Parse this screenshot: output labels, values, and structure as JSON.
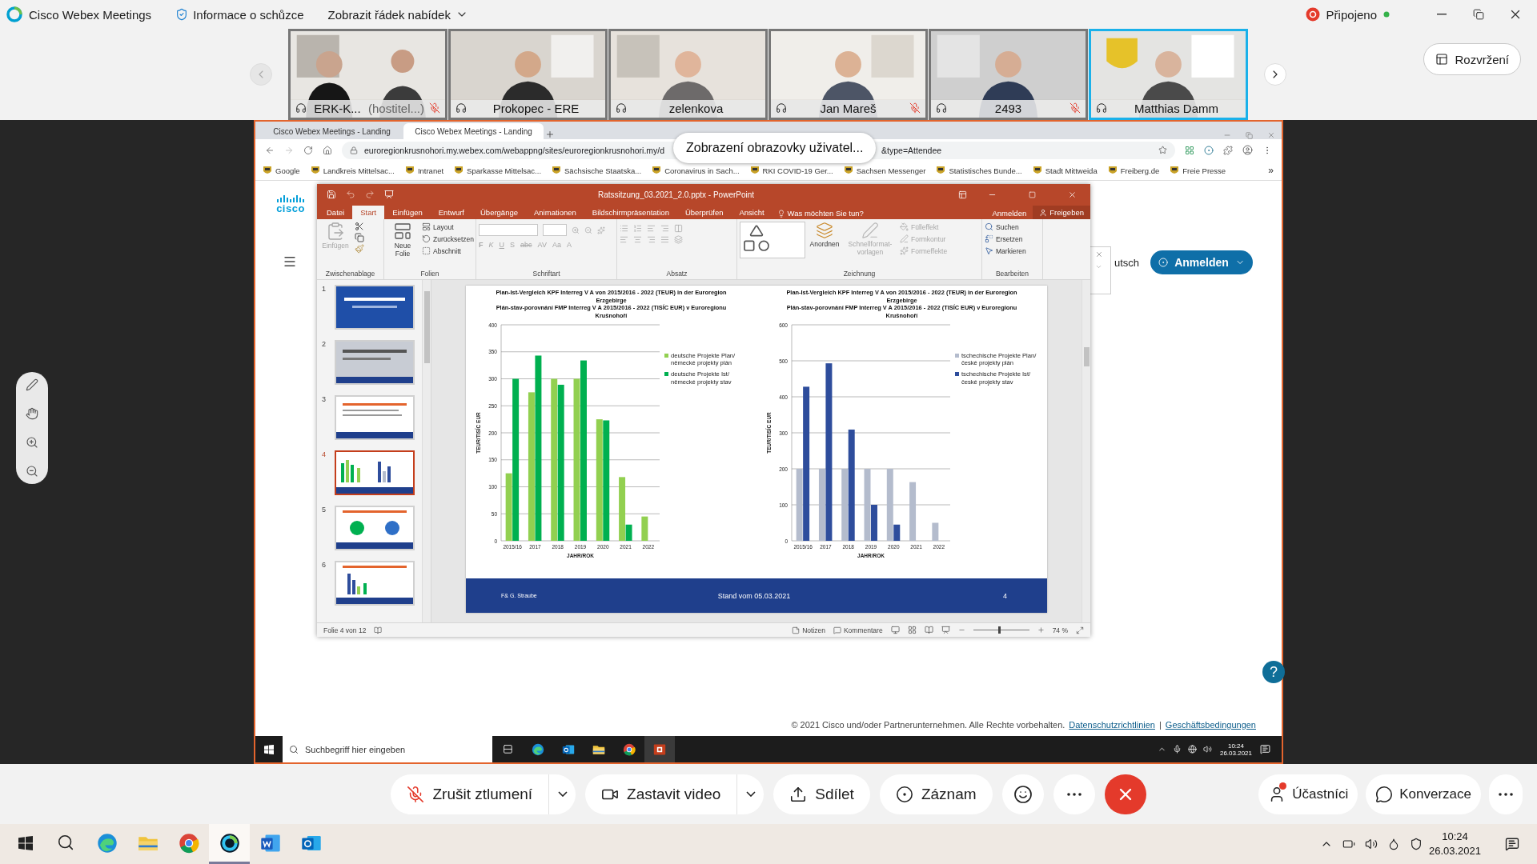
{
  "app_bar": {
    "title": "Cisco Webex Meetings",
    "meeting_info": "Informace o schůzce",
    "menu_toggle": "Zobrazit řádek nabídek",
    "status": "Připojeno"
  },
  "participants": [
    {
      "name": "ERK-K...",
      "role": "(hostitel...)",
      "muted": true,
      "active": false
    },
    {
      "name": "Prokopec - ERE",
      "muted": false,
      "active": false
    },
    {
      "name": "zelenkova",
      "muted": false,
      "active": false
    },
    {
      "name": "Jan Mareš",
      "muted": true,
      "active": false
    },
    {
      "name": "2493",
      "muted": true,
      "active": false
    },
    {
      "name": "Matthias Damm",
      "muted": false,
      "active": true
    }
  ],
  "layout_button": "Rozvržení",
  "browser": {
    "tabs": [
      {
        "title": "Cisco Webex Meetings - Landing",
        "selected": false
      },
      {
        "title": "Cisco Webex Meetings - Landing",
        "selected": true
      }
    ],
    "url_start": "euroregionkrusnohori.my.webex.com/webappng/sites/euroregionkrusnohori.my/d",
    "url_end": "&type=Attendee",
    "bookmarks": [
      "Google",
      "Landkreis Mittelsac...",
      "Intranet",
      "Sparkasse Mittelsac...",
      "Sächsische Staatska...",
      "Coronavirus in Sach...",
      "RKI COVID-19 Ger...",
      "Sachsen Messenger",
      "Statistisches Bunde...",
      "Stadt Mittweida",
      "Freiberg.de",
      "Freie Presse"
    ],
    "bookmarks_more": "»"
  },
  "share_label": "Zobrazení obrazovky uživatel...",
  "page": {
    "logo": "cisco",
    "language": "utsch",
    "sign_in": "Anmelden",
    "help": "?",
    "copyright": "© 2021 Cisco und/oder Partnerunternehmen. Alle Rechte vorbehalten.",
    "links": [
      "Datenschutzrichtlinien",
      "Geschäftsbedingungen"
    ],
    "separator": "|"
  },
  "powerpoint": {
    "title": "Ratssitzung_03.2021_2.0.pptx - PowerPoint",
    "tabs": [
      {
        "label": "Datei",
        "selected": false
      },
      {
        "label": "Start",
        "selected": true
      },
      {
        "label": "Einfügen",
        "selected": false
      },
      {
        "label": "Entwurf",
        "selected": false
      },
      {
        "label": "Übergänge",
        "selected": false
      },
      {
        "label": "Animationen",
        "selected": false
      },
      {
        "label": "Bildschirmpräsentation",
        "selected": false
      },
      {
        "label": "Überprüfen",
        "selected": false
      },
      {
        "label": "Ansicht",
        "selected": false
      }
    ],
    "tell_me": "Was möchten Sie tun?",
    "account": "Anmelden",
    "share": "Freigeben",
    "groups": [
      {
        "kind": "clipboard",
        "label": "Zwischenablage",
        "commands": [
          {
            "label": "Einfügen",
            "disabled": true
          }
        ]
      },
      {
        "kind": "slides",
        "label": "Folien",
        "commands": [
          {
            "label": "Neue Folie",
            "disabled": false
          },
          {
            "label": "Layout",
            "disabled": false
          },
          {
            "label": "Zurücksetzen",
            "disabled": false
          },
          {
            "label": "Abschnitt",
            "disabled": false
          }
        ]
      },
      {
        "kind": "font",
        "label": "Schriftart",
        "commands": [
          {
            "label": "F",
            "disabled": true
          },
          {
            "label": "K",
            "disabled": true
          },
          {
            "label": "U",
            "disabled": true
          },
          {
            "label": "S",
            "disabled": true
          },
          {
            "label": "abc",
            "disabled": true
          },
          {
            "label": "AV",
            "disabled": true
          },
          {
            "label": "Aa",
            "disabled": true
          },
          {
            "label": "A",
            "disabled": true
          }
        ]
      },
      {
        "kind": "paragraph",
        "label": "Absatz"
      },
      {
        "kind": "drawing",
        "label": "Zeichnung",
        "commands": [
          {
            "label": "Anordnen",
            "disabled": false
          },
          {
            "label": "Schnellformat-vorlagen",
            "disabled": true
          },
          {
            "label": "Fülleffekt",
            "disabled": true
          },
          {
            "label": "Formkontur",
            "disabled": true
          },
          {
            "label": "Formeffekte",
            "disabled": true
          }
        ]
      },
      {
        "kind": "editing",
        "label": "Bearbeiten",
        "commands": [
          {
            "label": "Suchen",
            "disabled": false
          },
          {
            "label": "Ersetzen",
            "disabled": false
          },
          {
            "label": "Markieren",
            "disabled": false
          }
        ]
      }
    ],
    "thumbnails": [
      {
        "number": "1",
        "selected": false
      },
      {
        "number": "2",
        "selected": false
      },
      {
        "number": "3",
        "selected": false
      },
      {
        "number": "4",
        "selected": true
      },
      {
        "number": "5",
        "selected": false
      },
      {
        "number": "6",
        "selected": false
      }
    ],
    "slide": {
      "charts": [
        {
          "title": "Plan-Ist-Vergleich KPF Interreg V A von 2015/2016 - 2022 (TEUR) in der Euroregion Erzgebirge",
          "subtitle": "Plán-stav-porovnání FMP Interreg V A 2015/2016 - 2022 (TISÍC EUR) v Euroregionu Krušnohoří",
          "chart_data": {
            "type": "bar",
            "xlabel": "JAHR/ROK",
            "ylabel": "TEUR/TISÍC EUR",
            "categories": [
              "2015/16",
              "2017",
              "2018",
              "2019",
              "2020",
              "2021",
              "2022"
            ],
            "grid": true,
            "ylim": [
              0,
              400
            ],
            "yticks": [
              0,
              50,
              100,
              150,
              200,
              250,
              300,
              350,
              400
            ],
            "series": [
              {
                "name": "deutsche Projekte Plan/ německé projekty plán",
                "color": "#92d050",
                "values": [
                  125,
                  275,
                  300,
                  300,
                  225,
                  118,
                  45
                ]
              },
              {
                "name": "deutsche Projekte Ist/ německé projekty stav",
                "color": "#00b050",
                "values": [
                  300,
                  343,
                  289,
                  334,
                  223,
                  30,
                  null
                ]
              }
            ]
          }
        },
        {
          "title": "Plan-Ist-Vergleich KPF Interreg V A von 2015/2016 - 2022 (TEUR) in der Euroregion Erzgebirge",
          "subtitle": "Plán-stav-porovnání FMP Interreg V A 2015/2016 - 2022 (TISÍC EUR) v Euroregionu Krušnohoří",
          "chart_data": {
            "type": "bar",
            "xlabel": "JAHR/ROK",
            "ylabel": "TEUR/TISÍC EUR",
            "categories": [
              "2015/16",
              "2017",
              "2018",
              "2019",
              "2020",
              "2021",
              "2022"
            ],
            "grid": true,
            "ylim": [
              0,
              600
            ],
            "yticks": [
              0,
              100,
              200,
              300,
              400,
              500,
              600
            ],
            "series": [
              {
                "name": "tschechische Projekte Plan/ české projekty plán",
                "color": "#b4bccd",
                "values": [
                  200,
                  200,
                  200,
                  200,
                  200,
                  163,
                  50
                ]
              },
              {
                "name": "tschechische Projekte Ist/ české projekty stav",
                "color": "#2e4d9c",
                "values": [
                  428,
                  493,
                  309,
                  100,
                  45,
                  null,
                  null
                ]
              }
            ]
          }
        }
      ],
      "footer_author": "F& G. Straube",
      "footer_date": "Stand vom 05.03.2021",
      "number": "4"
    },
    "status": {
      "slide_info": "Folie 4 von 12",
      "notes": "Notizen",
      "comments": "Kommentare",
      "zoom": "74 %",
      "zoom_slider": {
        "level": 0.45
      }
    }
  },
  "shared_taskbar": {
    "search": "Suchbegriff hier eingeben",
    "time": "10:24",
    "date": "26.03.2021",
    "apps": [
      {
        "kind": "taskview",
        "active": false
      },
      {
        "kind": "edge",
        "active": false
      },
      {
        "kind": "outlook",
        "active": false
      },
      {
        "kind": "explorer",
        "active": false
      },
      {
        "kind": "chrome",
        "active": false
      },
      {
        "kind": "powerpoint",
        "active": true
      }
    ]
  },
  "controls": [
    {
      "kind": "mute",
      "label": "Zrušit ztlumení"
    },
    {
      "kind": "video",
      "label": "Zastavit video"
    },
    {
      "kind": "share",
      "label": "Sdílet"
    },
    {
      "kind": "record",
      "label": "Záznam"
    },
    {
      "kind": "reactions"
    },
    {
      "kind": "more"
    },
    {
      "kind": "end"
    }
  ],
  "side_controls": [
    {
      "kind": "participants",
      "label": "Účastníci"
    },
    {
      "kind": "chat",
      "label": "Konverzace"
    },
    {
      "kind": "more"
    }
  ],
  "taskbar": {
    "time": "10:24",
    "date": "26.03.2021",
    "apps": [
      {
        "kind": "search",
        "active": false
      },
      {
        "kind": "edge",
        "active": false
      },
      {
        "kind": "explorer",
        "active": false
      },
      {
        "kind": "chrome",
        "active": false
      },
      {
        "kind": "webex",
        "active": true
      },
      {
        "kind": "word",
        "active": false
      },
      {
        "kind": "outlook",
        "active": false
      }
    ]
  }
}
